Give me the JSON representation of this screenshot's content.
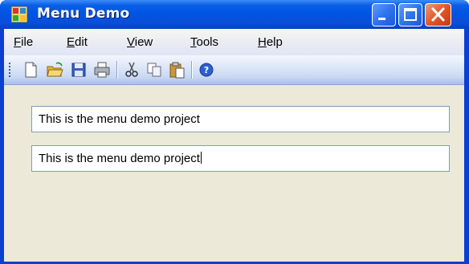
{
  "window": {
    "title": "Menu Demo",
    "controls": {
      "minimize_icon": "minimize-icon",
      "maximize_icon": "maximize-icon",
      "close_icon": "close-icon"
    }
  },
  "menubar": {
    "items": [
      {
        "label": "File",
        "mnemonic": "F",
        "rest": "ile"
      },
      {
        "label": "Edit",
        "mnemonic": "E",
        "rest": "dit"
      },
      {
        "label": "View",
        "mnemonic": "V",
        "rest": "iew"
      },
      {
        "label": "Tools",
        "mnemonic": "T",
        "rest": "ools"
      },
      {
        "label": "Help",
        "mnemonic": "H",
        "rest": "elp"
      }
    ]
  },
  "toolbar": {
    "buttons": [
      "new-icon",
      "open-icon",
      "save-icon",
      "print-icon",
      "cut-icon",
      "copy-icon",
      "paste-icon",
      "help-icon"
    ]
  },
  "textboxes": {
    "first_value": "This is the menu demo project",
    "second_value": "This is the menu demo project"
  },
  "colors": {
    "title_bar": "#0054e3",
    "client_bg": "#ece9d8",
    "close_button": "#e2562a"
  }
}
